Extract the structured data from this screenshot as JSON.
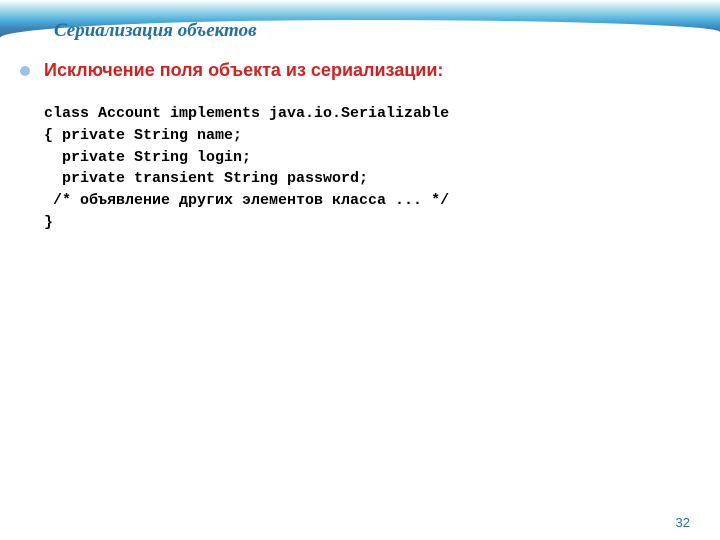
{
  "slide": {
    "title": "Сериализация объектов",
    "subtitle": "Исключение поля объекта из сериализации:",
    "code_lines": [
      "class Account implements java.io.Serializable",
      "{ private String name;",
      "  private String login;",
      "  private transient String password;",
      " /* объявление других элементов класса ... */",
      "}"
    ],
    "page_number": "32"
  }
}
